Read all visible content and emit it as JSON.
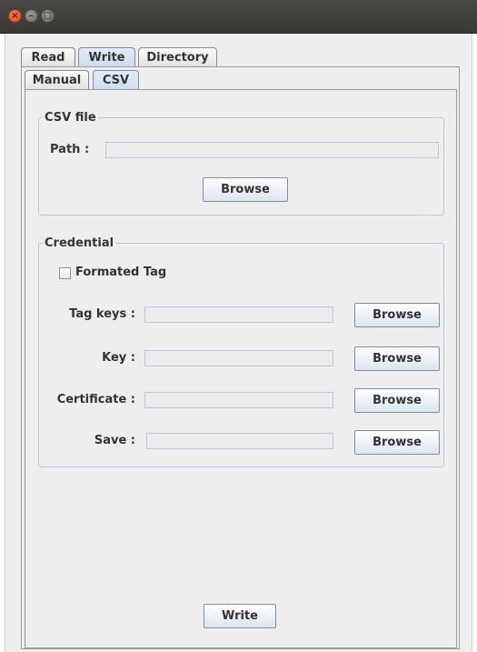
{
  "window": {
    "titlebar_buttons": {
      "close_icon": "close-icon",
      "minimize_icon": "minimize-icon",
      "maximize_icon": "maximize-icon"
    }
  },
  "tabs": [
    {
      "label": "Read",
      "selected": false
    },
    {
      "label": "Write",
      "selected": true
    },
    {
      "label": "Directory",
      "selected": false
    }
  ],
  "subtabs": [
    {
      "label": "Manual",
      "selected": false
    },
    {
      "label": "CSV",
      "selected": true
    }
  ],
  "csv_file": {
    "legend": "CSV file",
    "path_label": "Path :",
    "path_value": "",
    "browse_label": "Browse"
  },
  "credential": {
    "legend": "Credential",
    "formated_tag_label": "Formated Tag",
    "formated_tag_checked": false,
    "rows": [
      {
        "label": "Tag keys :",
        "value": "",
        "button": "Browse"
      },
      {
        "label": "Key :",
        "value": "",
        "button": "Browse"
      },
      {
        "label": "Certificate :",
        "value": "",
        "button": "Browse"
      },
      {
        "label": "Save :",
        "value": "",
        "button": "Browse"
      }
    ]
  },
  "footer": {
    "write_label": "Write"
  },
  "colors": {
    "titlebar": "#3c3b37",
    "close_button": "#e0582c",
    "selected_tab": "#cddcef",
    "panel_bg": "#eeeeee",
    "group_border": "#b7c6dc"
  }
}
